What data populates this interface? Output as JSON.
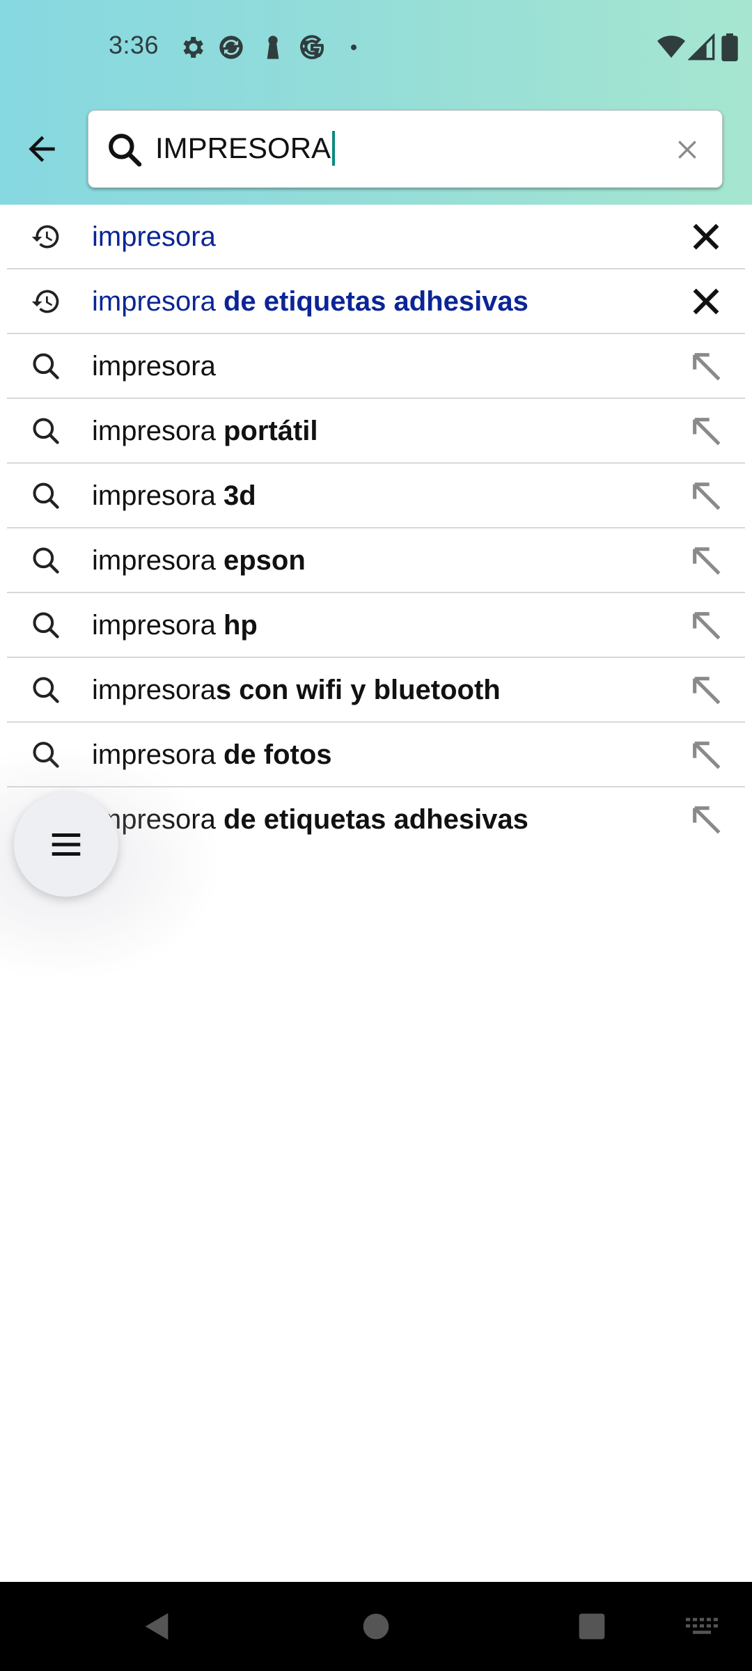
{
  "status_bar": {
    "time": "3:36",
    "left_icons": [
      "gear-icon",
      "sync-icon",
      "keyhole-icon",
      "google-icon",
      "dot-icon"
    ],
    "right_icons": [
      "wifi-icon",
      "signal-icon",
      "battery-icon"
    ]
  },
  "search": {
    "value": "IMPRESORA",
    "back_icon": "arrow-left-icon",
    "search_icon": "search-icon",
    "clear_icon": "close-icon"
  },
  "suggestions": [
    {
      "type": "history",
      "prefix": "impresora",
      "bold": "",
      "trail_icon": "close-icon"
    },
    {
      "type": "history",
      "prefix": "impresora ",
      "bold": "de etiquetas adhesivas",
      "trail_icon": "close-icon"
    },
    {
      "type": "search",
      "prefix": "impresora",
      "bold": "",
      "trail_icon": "arrow-up-left-icon"
    },
    {
      "type": "search",
      "prefix": "impresora ",
      "bold": "portátil",
      "trail_icon": "arrow-up-left-icon"
    },
    {
      "type": "search",
      "prefix": "impresora ",
      "bold": "3d",
      "trail_icon": "arrow-up-left-icon"
    },
    {
      "type": "search",
      "prefix": "impresora ",
      "bold": "epson",
      "trail_icon": "arrow-up-left-icon"
    },
    {
      "type": "search",
      "prefix": "impresora ",
      "bold": "hp",
      "trail_icon": "arrow-up-left-icon"
    },
    {
      "type": "search",
      "prefix": "impresora",
      "bold": "s con wifi y bluetooth",
      "trail_icon": "arrow-up-left-icon"
    },
    {
      "type": "search",
      "prefix": "impresora ",
      "bold": "de fotos",
      "trail_icon": "arrow-up-left-icon"
    },
    {
      "type": "search",
      "prefix": "impresora ",
      "bold": "de etiquetas adhesivas",
      "trail_icon": "arrow-up-left-icon"
    }
  ],
  "fab": {
    "icon": "menu-icon"
  },
  "nav_bar": {
    "icons": [
      "back-triangle-icon",
      "home-circle-icon",
      "recents-square-icon",
      "keyboard-icon"
    ]
  },
  "colors": {
    "header_gradient_start": "#86d8e1",
    "header_gradient_end": "#a6e6d0",
    "history_text": "#0b2596",
    "caret": "#0d8a7f",
    "divider": "#d8d8d8"
  }
}
